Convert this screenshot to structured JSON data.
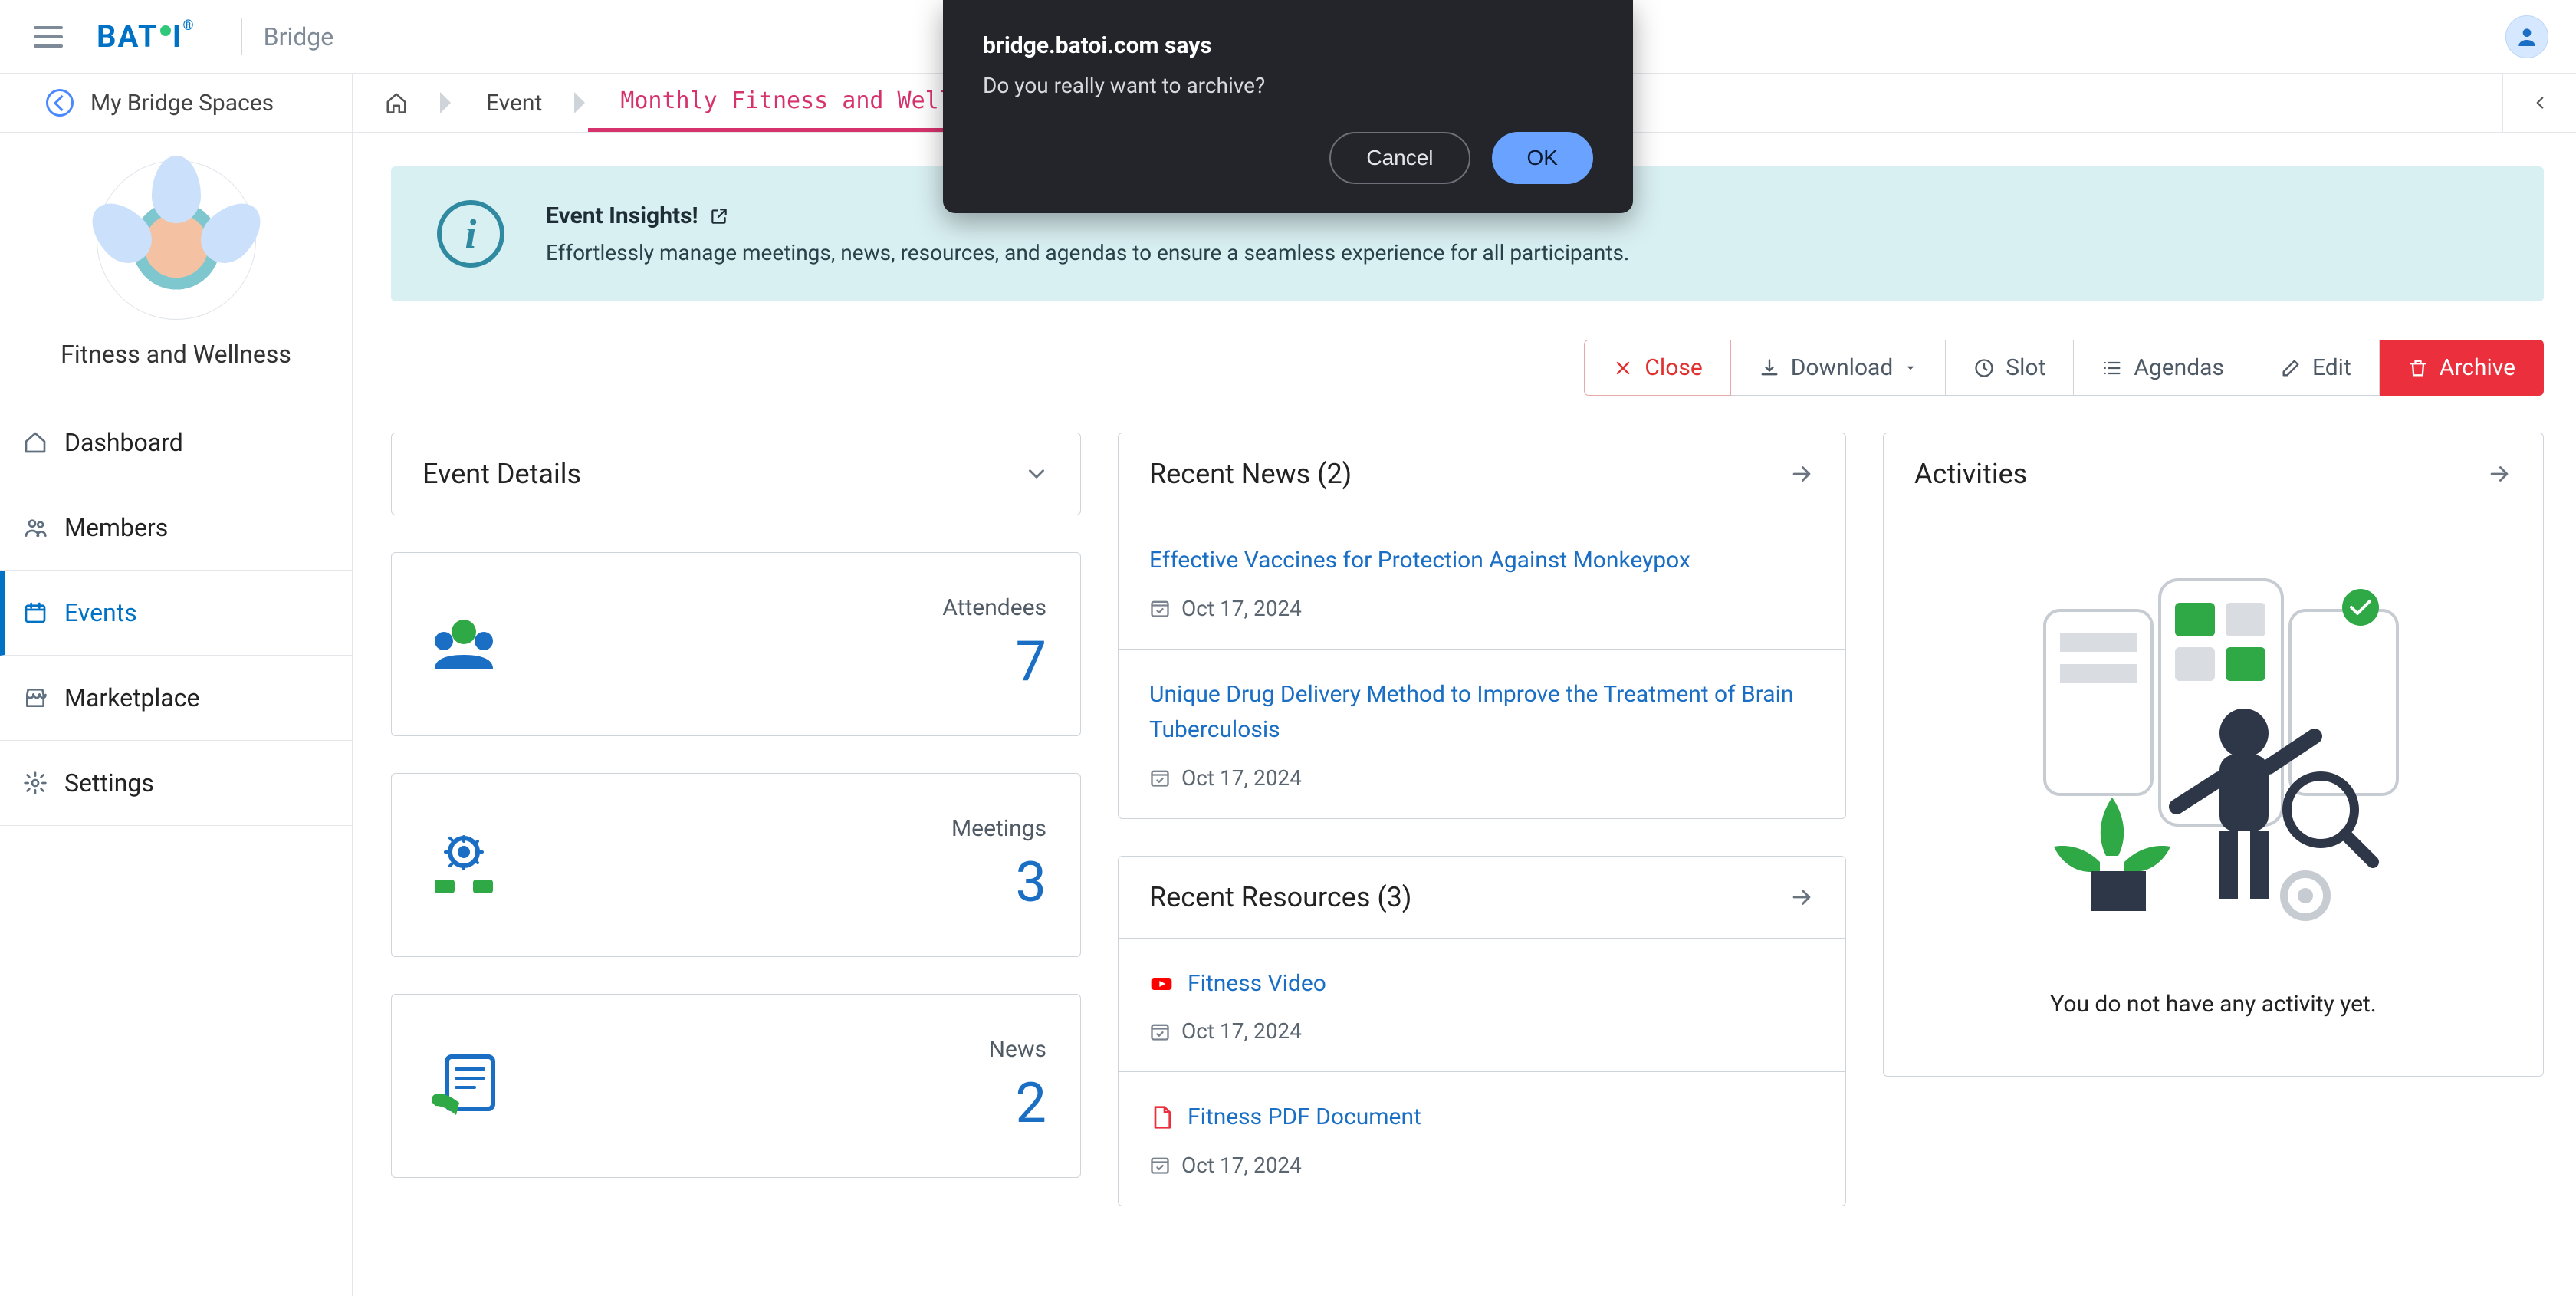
{
  "topbar": {
    "brand": "BATOI",
    "product": "Bridge"
  },
  "breadcrumb": {
    "back_label": "My Bridge Spaces",
    "event_label": "Event",
    "current_label": "Monthly Fitness and Wellness Reunion"
  },
  "space": {
    "title": "Fitness and Wellness"
  },
  "sidebar": {
    "items": [
      {
        "label": "Dashboard"
      },
      {
        "label": "Members"
      },
      {
        "label": "Events"
      },
      {
        "label": "Marketplace"
      },
      {
        "label": "Settings"
      }
    ]
  },
  "insights": {
    "title": "Event Insights!",
    "desc": "Effortlessly manage meetings, news, resources, and agendas to ensure a seamless experience for all participants."
  },
  "actions": {
    "close": "Close",
    "download": "Download",
    "slot": "Slot",
    "agendas": "Agendas",
    "edit": "Edit",
    "archive": "Archive"
  },
  "event_details": {
    "heading": "Event Details",
    "stats": {
      "attendees_label": "Attendees",
      "attendees_value": "7",
      "meetings_label": "Meetings",
      "meetings_value": "3",
      "news_label": "News",
      "news_value": "2"
    }
  },
  "recent_news": {
    "heading": "Recent News (2)",
    "items": [
      {
        "title": "Effective Vaccines for Protection Against Monkeypox",
        "date": "Oct 17, 2024"
      },
      {
        "title": "Unique Drug Delivery Method to Improve the Treatment of Brain Tuberculosis",
        "date": "Oct 17, 2024"
      }
    ]
  },
  "recent_resources": {
    "heading": "Recent Resources (3)",
    "items": [
      {
        "title": "Fitness Video",
        "date": "Oct 17, 2024",
        "type": "video"
      },
      {
        "title": "Fitness PDF Document",
        "date": "Oct 17, 2024",
        "type": "pdf"
      }
    ]
  },
  "activities": {
    "heading": "Activities",
    "empty_message": "You do not have any activity yet."
  },
  "alert": {
    "title": "bridge.batoi.com says",
    "message": "Do you really want to archive?",
    "cancel": "Cancel",
    "ok": "OK"
  }
}
